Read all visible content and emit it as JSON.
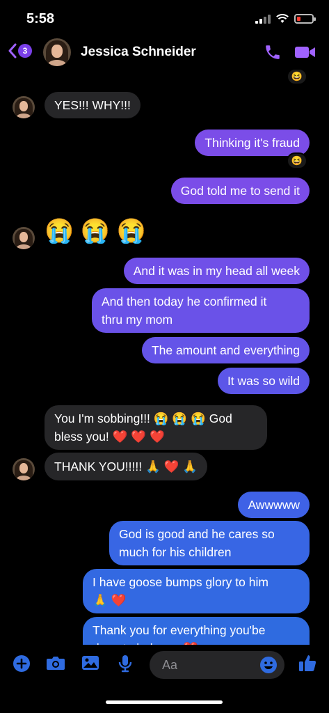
{
  "status": {
    "time": "5:58"
  },
  "header": {
    "back_badge": "3",
    "contact_name": "Jessica Schneider",
    "accent_color": "#a062ff"
  },
  "messages": {
    "m1": "YES!!! WHY!!!",
    "m2": "Thinking it's fraud",
    "m3": "God told me to send it",
    "m4": "😭 😭 😭",
    "m5": "And it was in my head all week",
    "m6a": "And then today he confirmed it",
    "m6b": "thru my mom",
    "m7": "The amount and everything",
    "m8": "It was so wild",
    "m9a": "You I'm sobbing!!! 😭 😭 😭 God",
    "m9b": "bless you! ❤️ ❤️ ❤️",
    "m10": "THANK YOU!!!!! 🙏 ❤️ 🙏",
    "m11": "Awwwww",
    "m12a": "God is good and he cares so",
    "m12b": "much for his children",
    "m13a": "I have goose bumps glory to him",
    "m13b": "🙏 ❤️",
    "m14a": "Thank you for everything you'be",
    "m14b": "done to help me ❤️"
  },
  "reactions": {
    "laugh": "😆"
  },
  "composer": {
    "placeholder": "Aa",
    "emoji": "😊"
  },
  "colors": {
    "sent_purple": "#7b4de8",
    "sent_blue": "#2f6be0",
    "received": "#262628"
  }
}
